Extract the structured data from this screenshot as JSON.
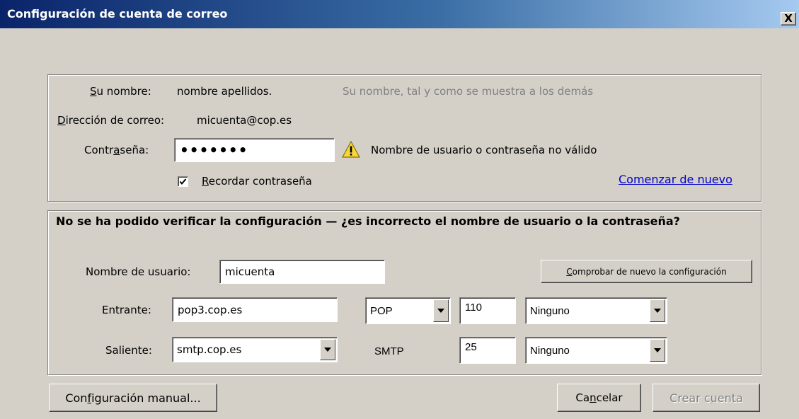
{
  "window": {
    "title": "Configuración de cuenta de correo",
    "close_label": "X"
  },
  "identity": {
    "name_label_prefix": "",
    "name_label_accel": "S",
    "name_label_rest": "u nombre:",
    "name_value": "nombre apellidos.",
    "name_hint": "Su nombre, tal y como se muestra a los demás",
    "email_label_accel": "D",
    "email_label_rest": "irección de correo:",
    "email_value": "micuenta@cop.es",
    "password_label_prefix": "Contr",
    "password_label_accel": "a",
    "password_label_rest": "seña:",
    "password_value": "•••••••",
    "warning_icon": "warning-icon",
    "warning_text": "Nombre de usuario o contraseña no válido",
    "remember_accel": "R",
    "remember_rest": "ecordar contraseña",
    "remember_checked": true,
    "start_over_link": "Comenzar de nuevo"
  },
  "config": {
    "heading": "No se ha podido verificar la configuración — ¿es incorrecto el nombre de usuario o la contraseña?",
    "username_label": "Nombre de usuario:",
    "username_value": "micuenta",
    "recheck_accel": "C",
    "recheck_rest": "omprobar de nuevo la configuración",
    "incoming_label": "Entrante:",
    "incoming_server": "pop3.cop.es",
    "incoming_protocol": "POP",
    "incoming_port": "110",
    "incoming_security": "Ninguno",
    "outgoing_label": "Saliente:",
    "outgoing_server": "smtp.cop.es",
    "outgoing_protocol": "SMTP",
    "outgoing_port": "25",
    "outgoing_security": "Ninguno"
  },
  "footer": {
    "manual_prefix": "Con",
    "manual_accel": "f",
    "manual_rest": "iguración manual...",
    "cancel_prefix": "Ca",
    "cancel_accel": "n",
    "cancel_rest": "celar",
    "create_prefix": "Crear c",
    "create_accel": "u",
    "create_rest": "enta"
  }
}
